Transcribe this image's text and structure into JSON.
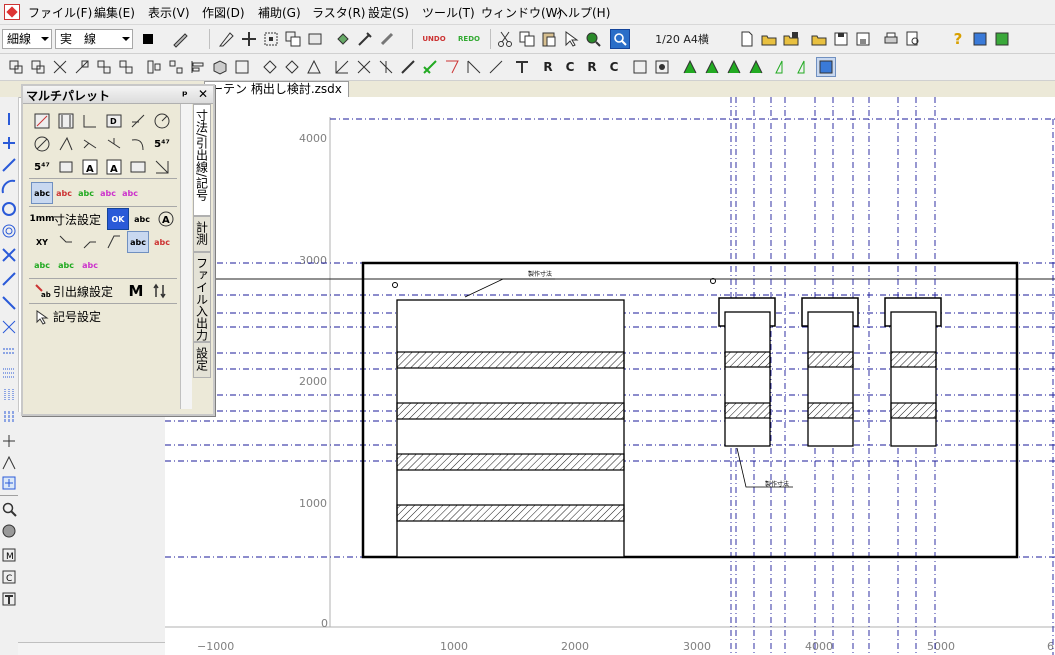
{
  "menubar": {
    "items": [
      "ファイル(F)",
      "編集(E)",
      "表示(V)",
      "作図(D)",
      "補助(G)",
      "ラスタ(R)",
      "設定(S)",
      "ツール(T)",
      "ウィンドウ(W)",
      "ヘルプ(H)"
    ]
  },
  "toolbar": {
    "line_width": "細線",
    "line_type": "実　線",
    "scale_paper": "1/20 A4横",
    "undo_label": "UNDO",
    "redo_label": "REDO"
  },
  "document_tab": {
    "title": "ーテン 柄出し検討.zsdx"
  },
  "palette": {
    "title": "マルチパレット",
    "pin": "ᵖ",
    "close": "✕",
    "dim_setting": "寸法設定",
    "leader_setting": "引出線設定",
    "symbol_setting": "記号設定",
    "ok_label": "OK",
    "m_label": "M",
    "unit_label": "1mm",
    "tabs": [
      "寸法/引出線/記号",
      "計測",
      "ファイル入出力",
      "設定"
    ]
  },
  "canvas": {
    "y_ticks": [
      "4000",
      "3000",
      "2000",
      "1000",
      "0"
    ],
    "x_ticks": [
      "−1000",
      "1000",
      "2000",
      "3000",
      "4000",
      "5000",
      "6"
    ],
    "annotation_top": "製作寸法",
    "annotation_right": "製作寸法"
  }
}
